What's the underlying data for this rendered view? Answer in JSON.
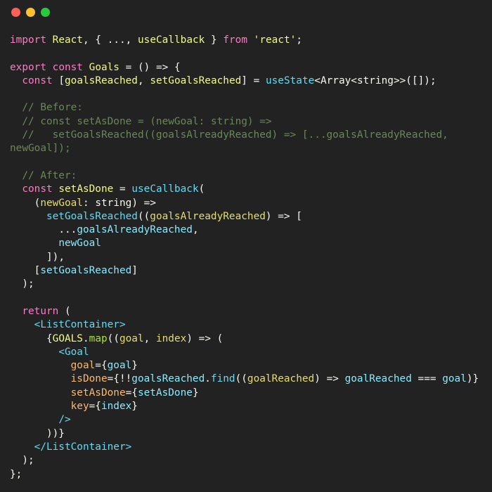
{
  "window": {
    "title": "",
    "background_color": "#222222",
    "controls": [
      {
        "name": "close",
        "label": "",
        "color": "#FC6058"
      },
      {
        "name": "minimize",
        "label": "",
        "color": "#FEC02F"
      },
      {
        "name": "maximize",
        "label": "",
        "color": "#2ACA3E"
      }
    ]
  },
  "theme": {
    "keyword": "#ff79c6",
    "declaration": "#f1fa8c",
    "function": "#66d9ef",
    "variable": "#8be9fd",
    "property": "#a6e22e",
    "parameter": "#e6db74",
    "string": "#f1fa8c",
    "comment": "#6a8759",
    "tag": "#66d9ef",
    "attribute": "#ffb86c",
    "plain": "#f8f8f2"
  },
  "code": {
    "language": "tsx",
    "lines": [
      "import React, { ..., useCallback } from 'react';",
      "",
      "export const Goals = () => {",
      "  const [goalsReached, setGoalsReached] = useState<Array<string>>([]);",
      "",
      "  // Before:",
      "  // const setAsDone = (newGoal: string) =>",
      "  //   setGoalsReached((goalsAlreadyReached) => [...goalsAlreadyReached, newGoal]);",
      "",
      "  // After:",
      "  const setAsDone = useCallback(",
      "    (newGoal: string) =>",
      "      setGoalsReached((goalsAlreadyReached) => [",
      "        ...goalsAlreadyReached,",
      "        newGoal",
      "      ]),",
      "    [setGoalsReached]",
      "  );",
      "",
      "  return (",
      "    <ListContainer>",
      "      {GOALS.map((goal, index) => (",
      "        <Goal",
      "          goal={goal}",
      "          isDone={!!goalsReached.find((goalReached) => goalReached === goal)}",
      "          setAsDone={setAsDone}",
      "          key={index}",
      "        />",
      "      ))}",
      "    </ListContainer>",
      "  );",
      "};"
    ],
    "tokens": {
      "keywords": [
        "import",
        "export",
        "const",
        "from",
        "return"
      ],
      "functions": [
        "useState",
        "useCallback",
        "setGoalsReached",
        "find"
      ],
      "declarations": [
        "React",
        "Goals",
        "goalsReached",
        "setGoalsReached",
        "setAsDone",
        "GOALS"
      ],
      "parameters": [
        "newGoal",
        "goalsAlreadyReached",
        "goal",
        "index",
        "goalReached"
      ],
      "jsx_tags": [
        "ListContainer",
        "Goal"
      ],
      "jsx_attributes": [
        "goal",
        "isDone",
        "setAsDone",
        "key"
      ],
      "strings": [
        "'react'"
      ],
      "types": [
        "Array",
        "string"
      ],
      "comments": [
        "// Before:",
        "// const setAsDone = (newGoal: string) =>",
        "//   setGoalsReached((goalsAlreadyReached) => [...goalsAlreadyReached, newGoal]);",
        "// After:"
      ]
    }
  }
}
